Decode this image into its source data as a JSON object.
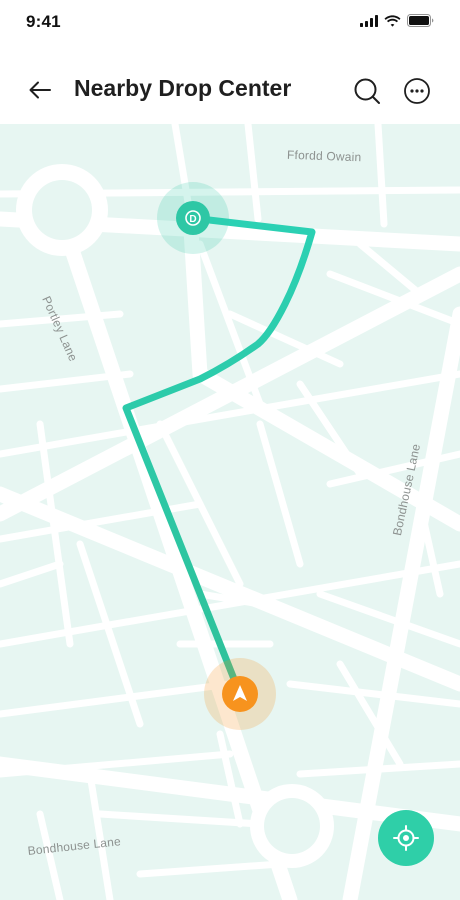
{
  "status_bar": {
    "time": "9:41",
    "icons": [
      "cellular-signal-icon",
      "wifi-icon",
      "battery-icon"
    ]
  },
  "header": {
    "title": "Nearby Drop Center",
    "back_icon": "arrow-left-icon",
    "search_icon": "search-icon",
    "more_icon": "more-horizontal-icon"
  },
  "map": {
    "streets": {
      "top": "Ffordd Owain",
      "left": "Portley Lane",
      "right": "Bondhouse Lane",
      "bottom": "Bondhouse Lane"
    },
    "destination_marker": {
      "letter": "D"
    },
    "current_location_icon": "navigation-arrow-icon",
    "locate_button_icon": "crosshair-icon"
  },
  "colors": {
    "map_background": "#e7f6f2",
    "road": "#ffffff",
    "route_start": "#2bd1b4",
    "route_end": "#2ec19a",
    "destination": "#2ec7a5",
    "current_location": "#f7931e",
    "locate_button": "#2fcfa8"
  }
}
